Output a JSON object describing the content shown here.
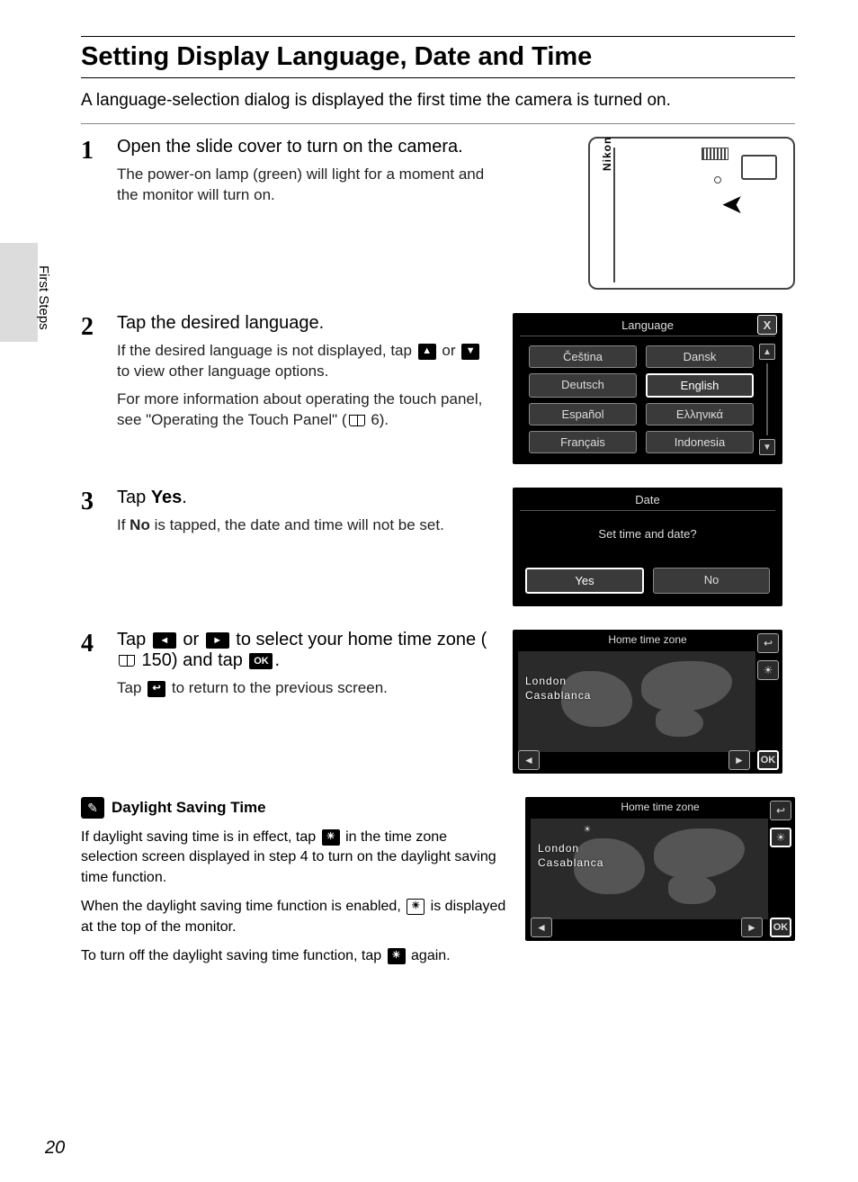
{
  "section_label": "First Steps",
  "title": "Setting Display Language, Date and Time",
  "intro": "A language-selection dialog is displayed the first time the camera is turned on.",
  "page_number": "20",
  "steps": {
    "s1": {
      "num": "1",
      "head": "Open the slide cover to turn on the camera.",
      "detail": "The power-on lamp (green) will light for a moment and the monitor will turn on.",
      "camera_brand": "Nikon"
    },
    "s2": {
      "num": "2",
      "head": "Tap the desired language.",
      "d1a": "If the desired language is not displayed, tap ",
      "d1b": " or ",
      "d1c": " to view other language options.",
      "d2a": "For more information about operating the touch panel, see \"Operating the Touch Panel\" (",
      "d2_ref": " 6).",
      "screen": {
        "title": "Language",
        "close": "X",
        "langs": [
          "Čeština",
          "Dansk",
          "Deutsch",
          "English",
          "Español",
          "Ελληνικά",
          "Français",
          "Indonesia"
        ]
      }
    },
    "s3": {
      "num": "3",
      "head_a": "Tap ",
      "head_b": "Yes",
      "head_c": ".",
      "d_a": "If ",
      "d_b": "No",
      "d_c": " is tapped, the date and time will not be set.",
      "screen": {
        "title": "Date",
        "question": "Set time and date?",
        "yes": "Yes",
        "no": "No"
      }
    },
    "s4": {
      "num": "4",
      "h_a": "Tap ",
      "h_b": " or ",
      "h_c": " to select your home time zone (",
      "h_ref": " 150) and tap ",
      "h_d": ".",
      "d_a": "Tap ",
      "d_b": " to return to the previous screen.",
      "screen": {
        "title": "Home time zone",
        "city1": "London",
        "city2": "Casablanca",
        "ok": "OK"
      }
    }
  },
  "note": {
    "title": "Daylight Saving Time",
    "p1a": "If daylight saving time is in effect, tap ",
    "p1b": " in the time zone selection screen displayed in step 4 to turn on the daylight saving time function.",
    "p2a": "When the daylight saving time function is enabled, ",
    "p2b": " is displayed at the top of the monitor.",
    "p3a": "To turn off the daylight saving time function, tap ",
    "p3b": " again.",
    "screen": {
      "title": "Home time zone",
      "city1": "London",
      "city2": "Casablanca",
      "ok": "OK"
    }
  }
}
